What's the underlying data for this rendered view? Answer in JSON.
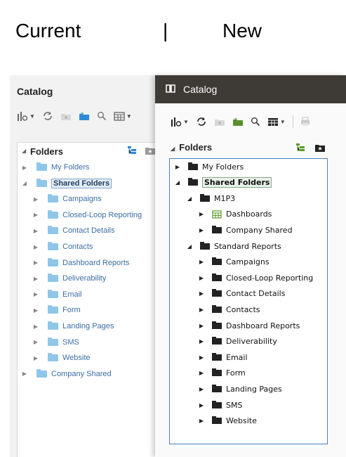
{
  "headings": {
    "current": "Current",
    "separator": "|",
    "new": "New"
  },
  "old": {
    "title": "Catalog",
    "folders_header": "Folders",
    "tree": [
      {
        "label": "My Folders",
        "expanded": false
      },
      {
        "label": "Shared Folders",
        "expanded": true,
        "selected": true
      },
      {
        "label": "Campaigns",
        "expanded": false
      },
      {
        "label": "Closed-Loop Reporting",
        "expanded": false
      },
      {
        "label": "Contact Details",
        "expanded": false
      },
      {
        "label": "Contacts",
        "expanded": false
      },
      {
        "label": "Dashboard Reports",
        "expanded": false
      },
      {
        "label": "Deliverability",
        "expanded": false
      },
      {
        "label": "Email",
        "expanded": false
      },
      {
        "label": "Form",
        "expanded": false
      },
      {
        "label": "Landing Pages",
        "expanded": false
      },
      {
        "label": "SMS",
        "expanded": false
      },
      {
        "label": "Website",
        "expanded": false
      },
      {
        "label": "Company Shared",
        "expanded": false
      }
    ],
    "folder_color": "#8fc6ea",
    "text_color": "#3b6ea5"
  },
  "new": {
    "title": "Catalog",
    "folders_header": "Folders",
    "tree": [
      {
        "label": "My Folders",
        "expanded": false
      },
      {
        "label": "Shared Folders",
        "expanded": true,
        "selected": true
      },
      {
        "label": "M1P3",
        "expanded": true
      },
      {
        "label": "Dashboards",
        "expanded": false,
        "icon": "dashboard-icon"
      },
      {
        "label": "Company Shared",
        "expanded": false
      },
      {
        "label": "Standard Reports",
        "expanded": true
      },
      {
        "label": "Campaigns",
        "expanded": false
      },
      {
        "label": "Closed-Loop Reporting",
        "expanded": false
      },
      {
        "label": "Contact Details",
        "expanded": false
      },
      {
        "label": "Contacts",
        "expanded": false
      },
      {
        "label": "Dashboard Reports",
        "expanded": false
      },
      {
        "label": "Deliverability",
        "expanded": false
      },
      {
        "label": "Email",
        "expanded": false
      },
      {
        "label": "Form",
        "expanded": false
      },
      {
        "label": "Landing Pages",
        "expanded": false
      },
      {
        "label": "SMS",
        "expanded": false
      },
      {
        "label": "Website",
        "expanded": false
      }
    ],
    "titlebar_color": "#3e3a36",
    "border_color": "#4c7fbf"
  }
}
